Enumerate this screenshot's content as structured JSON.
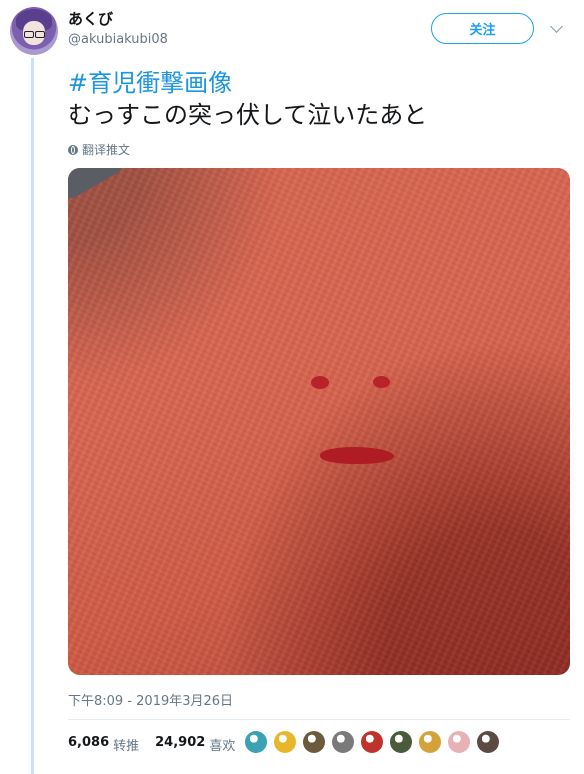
{
  "author": {
    "display_name": "あくび",
    "handle": "@akubiakubi08"
  },
  "follow_label": "关注",
  "tweet": {
    "hashtag": "#育児衝撃画像",
    "text": "むっすこの突っ伏して泣いたあと",
    "translate_label": "翻译推文"
  },
  "timestamp": "下午8:09 - 2019年3月26日",
  "stats": {
    "retweets_count": "6,086",
    "retweets_label": "转推",
    "likes_count": "24,902",
    "likes_label": "喜欢"
  },
  "colors": {
    "accent": "#1da1f2",
    "hashtag": "#1b95e0",
    "muted": "#657786",
    "thread_line": "#c4e4f5"
  },
  "likers": [
    {
      "icon": "liker-avatar-1",
      "color": "#3aa3b3"
    },
    {
      "icon": "liker-avatar-2",
      "color": "#e8b62a"
    },
    {
      "icon": "liker-avatar-3",
      "color": "#6b5a3c"
    },
    {
      "icon": "liker-avatar-4",
      "color": "#7a7a7a"
    },
    {
      "icon": "liker-avatar-5",
      "color": "#c0322c"
    },
    {
      "icon": "liker-avatar-6",
      "color": "#4a5a3a"
    },
    {
      "icon": "liker-avatar-7",
      "color": "#d4a23a"
    },
    {
      "icon": "liker-avatar-8",
      "color": "#e7b2b6"
    },
    {
      "icon": "liker-avatar-9",
      "color": "#5d4a44"
    }
  ]
}
